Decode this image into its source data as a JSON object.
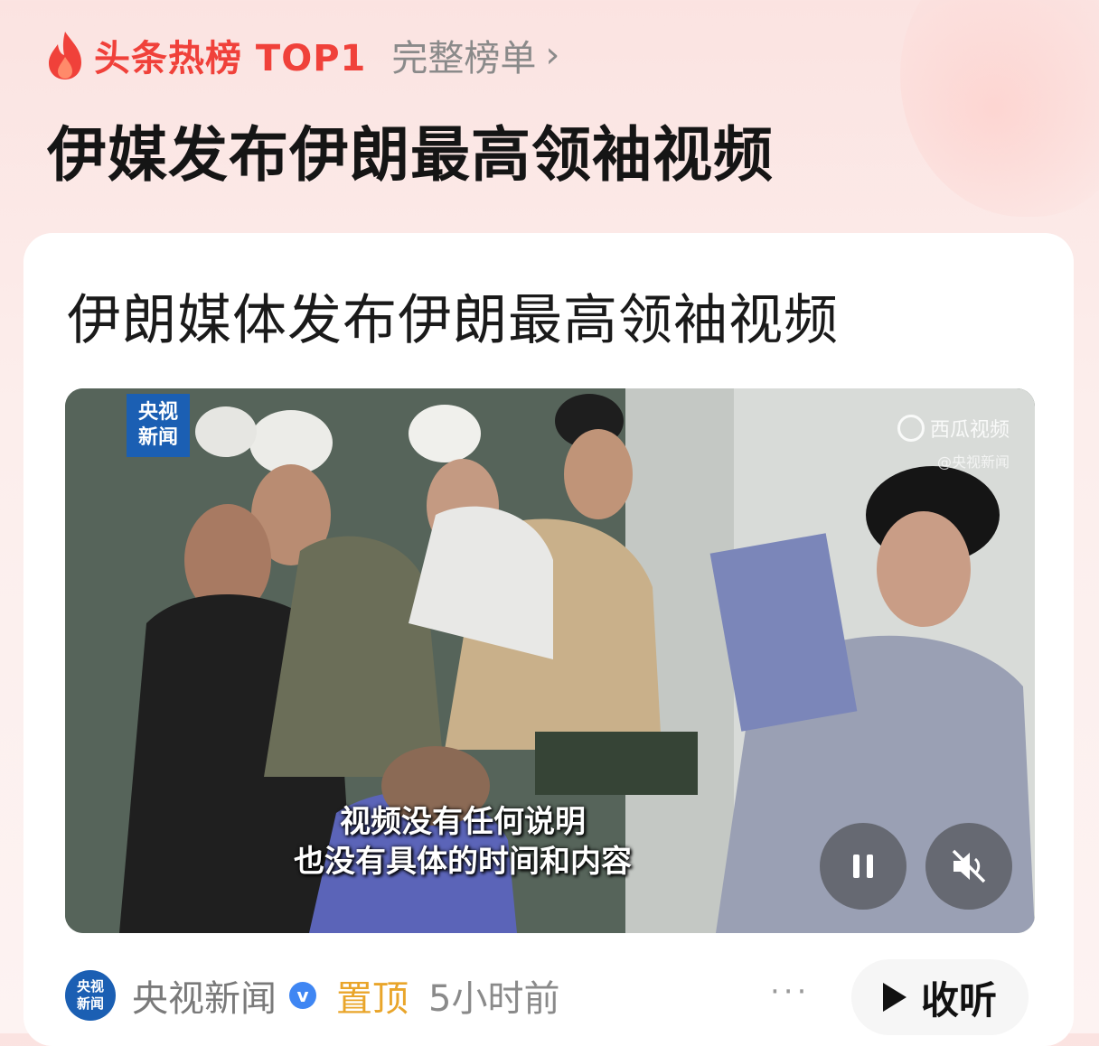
{
  "header": {
    "hot_label": "头条热榜 TOP1",
    "full_list_label": "完整榜单",
    "headline": "伊媒发布伊朗最高领袖视频",
    "accent_color": "#f0413a"
  },
  "card": {
    "title": "伊朗媒体发布伊朗最高领袖视频",
    "video": {
      "channel_logo": "央视\n新闻",
      "channel_logo_line1": "央视",
      "channel_logo_line2": "新闻",
      "watermark": "西瓜视频",
      "watermark_sub": "@央视新闻",
      "subtitle_line1": "视频没有任何说明",
      "subtitle_line2": "也没有具体的时间和内容",
      "controls": {
        "pause_icon": "pause-icon",
        "mute_icon": "mute-icon"
      }
    },
    "meta": {
      "avatar_line1": "央视",
      "avatar_line2": "新闻",
      "source": "央视新闻",
      "verified_mark": "v",
      "pinned": "置顶",
      "time": "5小时前",
      "more": "···",
      "listen_label": "收听",
      "pinned_color": "#e9a52a",
      "verified_color": "#3f86f3"
    }
  }
}
